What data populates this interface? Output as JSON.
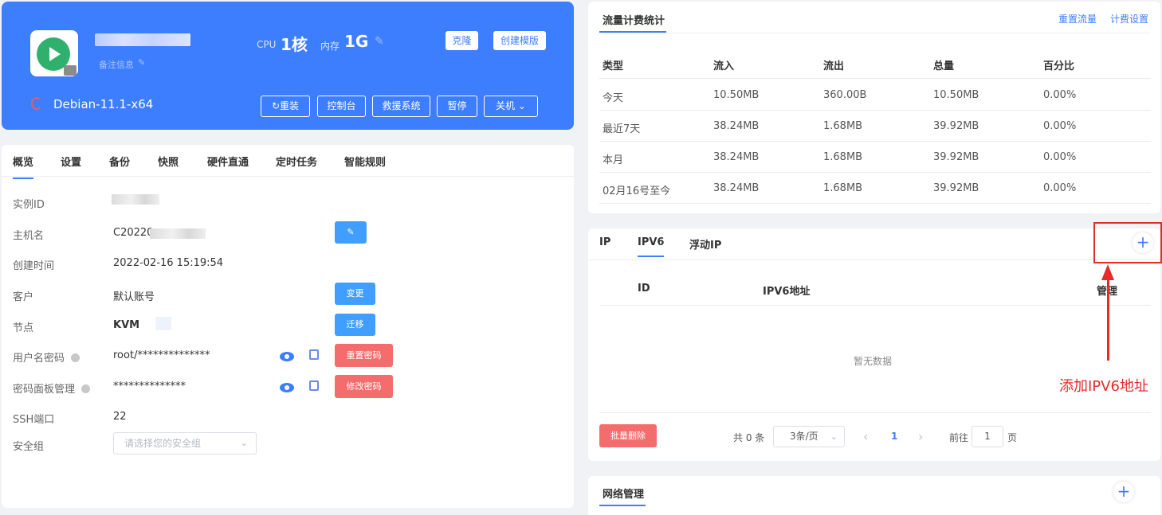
{
  "colors": {
    "accent": "#3d7efe",
    "danger": "#f56c6c",
    "primary_btn": "#409eff",
    "annotation": "#e52a2a"
  },
  "header": {
    "note_placeholder": "备注信息",
    "cpu_label": "CPU",
    "cpu_value": "1核",
    "mem_label": "内存",
    "mem_value": "1G",
    "clone_label": "克隆",
    "create_template_label": "创建模版",
    "os_name": "Debian-11.1-x64",
    "actions": {
      "reinstall": "重装",
      "console": "控制台",
      "rescue": "救援系统",
      "pause": "暂停",
      "shutdown": "关机"
    }
  },
  "overview": {
    "tabs": [
      "概览",
      "设置",
      "备份",
      "快照",
      "硬件直通",
      "定时任务",
      "智能规则"
    ],
    "fields": {
      "instance_id_label": "实例ID",
      "hostname_label": "主机名",
      "hostname_value": "C20220",
      "created_label": "创建时间",
      "created_value": "2022-02-16 15:19:54",
      "customer_label": "客户",
      "customer_value": "默认账号",
      "node_label": "节点",
      "node_value": "KVM",
      "user_pw_label": "用户名密码",
      "user_pw_value": "root/**************",
      "panel_pw_label": "密码面板管理",
      "panel_pw_value": "**************",
      "ssh_label": "SSH端口",
      "ssh_value": "22",
      "sg_label": "安全组",
      "sg_placeholder": "请选择您的安全组"
    },
    "buttons": {
      "change": "变更",
      "migrate": "迁移",
      "reset_pw": "重置密码",
      "modify_pw": "修改密码"
    }
  },
  "traffic": {
    "title": "流量计费统计",
    "reset_link": "重置流量",
    "billing_link": "计费设置",
    "headers": [
      "类型",
      "流入",
      "流出",
      "总量",
      "百分比"
    ],
    "rows": [
      [
        "今天",
        "10.50MB",
        "360.00B",
        "10.50MB",
        "0.00%"
      ],
      [
        "最近7天",
        "38.24MB",
        "1.68MB",
        "39.92MB",
        "0.00%"
      ],
      [
        "本月",
        "38.24MB",
        "1.68MB",
        "39.92MB",
        "0.00%"
      ],
      [
        "02月16号至今",
        "38.24MB",
        "1.68MB",
        "39.92MB",
        "0.00%"
      ]
    ]
  },
  "ip": {
    "tabs": [
      "IP",
      "IPV6",
      "浮动IP"
    ],
    "headers": [
      "ID",
      "IPV6地址",
      "管理"
    ],
    "empty_text": "暂无数据",
    "bulk_delete": "批量删除",
    "total": "共 0 条",
    "page_size": "3条/页",
    "current_page": "1",
    "goto_label": "前往",
    "goto_value": "1",
    "page_unit": "页"
  },
  "network": {
    "title": "网络管理"
  },
  "annotation": {
    "text": "添加IPV6地址"
  },
  "icons": {
    "plus": "+",
    "prev": "‹",
    "next": "›",
    "chevron": "⌄",
    "edit": "✎",
    "refresh": "↻"
  }
}
